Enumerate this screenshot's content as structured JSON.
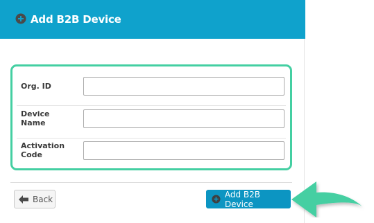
{
  "header": {
    "title": "Add B2B Device",
    "icon": "plus-circle-icon",
    "background_color": "#0fa2cc"
  },
  "form": {
    "highlight_color": "#44cfa2",
    "fields": [
      {
        "label": "Org. ID",
        "value": ""
      },
      {
        "label": "Device\nName",
        "value": ""
      },
      {
        "label": "Activation\nCode",
        "value": ""
      }
    ]
  },
  "footer": {
    "back_button": {
      "label": "Back",
      "icon": "arrow-left-icon"
    },
    "add_button": {
      "label": "Add B2B Device",
      "icon": "plus-circle-icon",
      "color": "#0c95c2"
    }
  },
  "annotation": {
    "icon": "pointing-arrow-icon",
    "color": "#44cfa2"
  }
}
